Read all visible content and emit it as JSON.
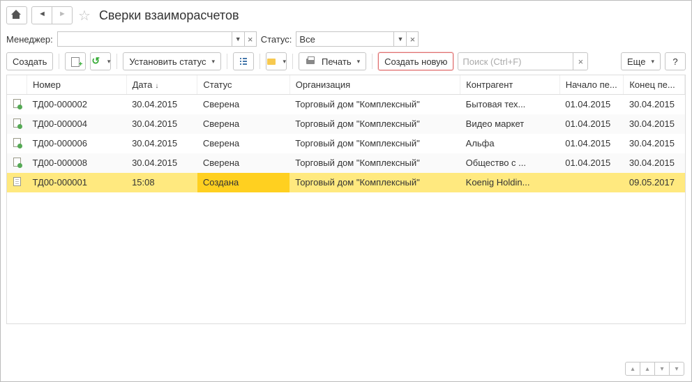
{
  "header": {
    "title": "Сверки взаиморасчетов"
  },
  "filters": {
    "manager_label": "Менеджер:",
    "manager_value": "",
    "status_label": "Статус:",
    "status_value": "Все"
  },
  "toolbar": {
    "create": "Создать",
    "set_status": "Установить статус",
    "print": "Печать",
    "create_new": "Создать новую",
    "search_placeholder": "Поиск (Ctrl+F)",
    "more": "Еще",
    "help": "?"
  },
  "columns": {
    "number": "Номер",
    "date": "Дата",
    "status": "Статус",
    "organization": "Организация",
    "counterparty": "Контрагент",
    "period_start": "Начало пе...",
    "period_end": "Конец пе..."
  },
  "rows": [
    {
      "icon": "ok",
      "number": "ТД00-000002",
      "date": "30.04.2015",
      "status": "Сверена",
      "org": "Торговый дом \"Комплексный\"",
      "ctr": "Бытовая тех...",
      "start": "01.04.2015",
      "end": "30.04.2015",
      "selected": false
    },
    {
      "icon": "ok",
      "number": "ТД00-000004",
      "date": "30.04.2015",
      "status": "Сверена",
      "org": "Торговый дом \"Комплексный\"",
      "ctr": "Видео маркет",
      "start": "01.04.2015",
      "end": "30.04.2015",
      "selected": false
    },
    {
      "icon": "ok",
      "number": "ТД00-000006",
      "date": "30.04.2015",
      "status": "Сверена",
      "org": "Торговый дом \"Комплексный\"",
      "ctr": "Альфа",
      "start": "01.04.2015",
      "end": "30.04.2015",
      "selected": false
    },
    {
      "icon": "ok",
      "number": "ТД00-000008",
      "date": "30.04.2015",
      "status": "Сверена",
      "org": "Торговый дом \"Комплексный\"",
      "ctr": "Общество с ...",
      "start": "01.04.2015",
      "end": "30.04.2015",
      "selected": false
    },
    {
      "icon": "plain",
      "number": "ТД00-000001",
      "date": "15:08",
      "status": "Создана",
      "org": "Торговый дом \"Комплексный\"",
      "ctr": "Koenig Holdin...",
      "start": "",
      "end": "09.05.2017",
      "selected": true
    }
  ]
}
